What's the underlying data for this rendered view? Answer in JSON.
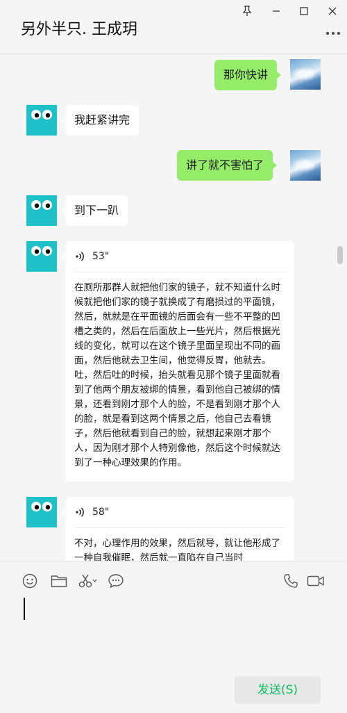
{
  "window": {
    "title": "另外半只. 王成玥",
    "pin_icon": "pin-icon",
    "minimize_icon": "minimize-icon",
    "maximize_icon": "maximize-icon",
    "close_icon": "close-icon",
    "more_icon": "more-icon"
  },
  "messages": [
    {
      "sender": "me",
      "text": "那你快讲"
    },
    {
      "sender": "peer",
      "text": "我赶紧讲完"
    },
    {
      "sender": "me",
      "text": "讲了就不害怕了"
    },
    {
      "sender": "peer",
      "text": "到下一趴"
    },
    {
      "sender": "peer",
      "type": "voice",
      "duration": "53\"",
      "transcript": "在厕所那群人就把他们家的镜子，就不知道什么时候就把他们家的镜子就换成了有磨损过的平面镜，然后，就就是在平面镜的后面会有一些不平整的凹槽之类的，然后在后面放上一些光片，然后根据光线的变化，就可以在这个镜子里面呈现出不同的画面，然后他就去卫生间，他觉得反胃，他就去。吐，然后吐的时候，抬头就看见那个镜子里面就看到了他两个朋友被绑的情景，看到他自己被绑的情景，还看到刚才那个人的脸，不是看到刚才那个人的脸，就是看到这两个情景之后，他自己去看镜子，然后他就看到自己的脸，就想起来刚才那个人，因为刚才那个人特别像他，然后这个时候就达到了一种心理效果的作用。"
    },
    {
      "sender": "peer",
      "type": "voice",
      "duration": "58\"",
      "transcript": "不对，心理作用的效果，然后就导，就让他形成了一种自我催眠，然后就一直陷在自己当时"
    }
  ],
  "composer": {
    "emoji_icon": "emoji-icon",
    "folder_icon": "folder-icon",
    "scissors_icon": "scissors-icon",
    "chat_history_icon": "chat-bubble-icon",
    "phone_icon": "phone-icon",
    "video_icon": "video-call-icon",
    "input_value": "",
    "send_label": "发送(S)"
  },
  "colors": {
    "accent_green": "#07c160",
    "bubble_me": "#95ec69",
    "bubble_peer": "#ffffff",
    "avatar_peer": "#1fc0c7",
    "background": "#f5f5f5"
  }
}
